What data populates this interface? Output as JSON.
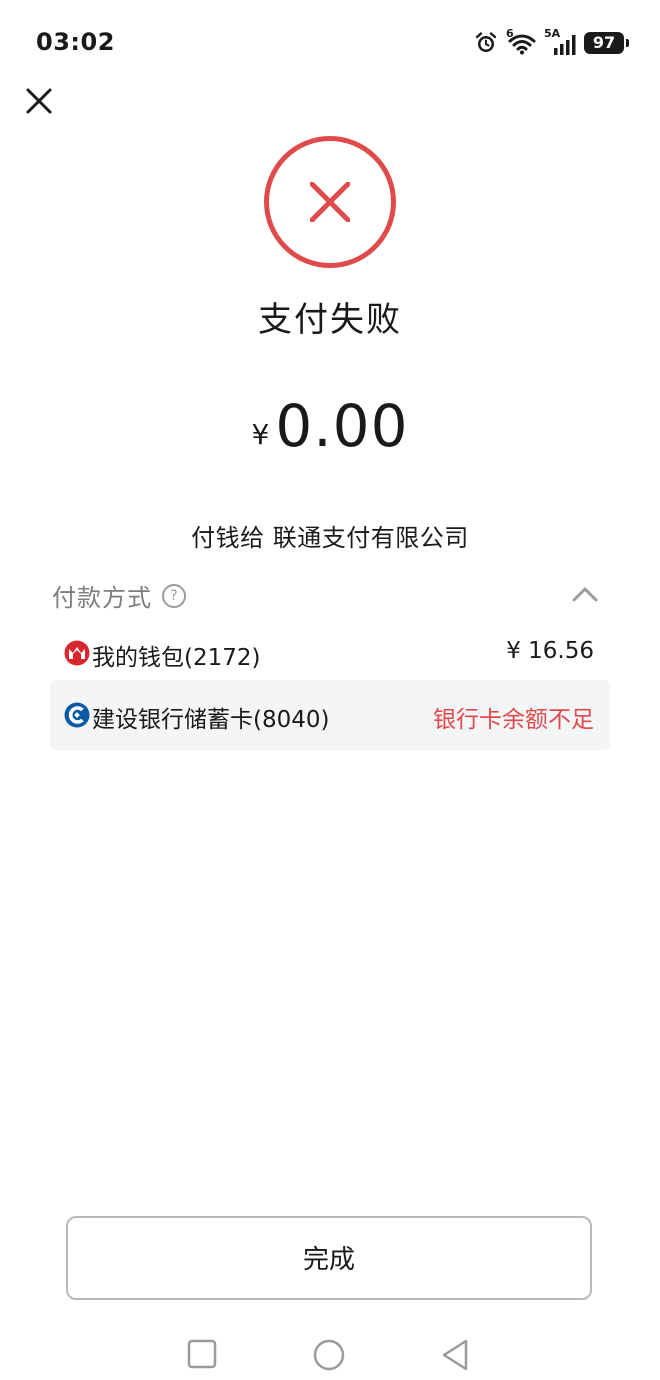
{
  "status_bar": {
    "time": "03:02",
    "network_wifi_label": "6",
    "network_cell_label": "5A",
    "battery": "97"
  },
  "result": {
    "title": "支付失败",
    "currency": "¥",
    "amount": "0.00",
    "payee": "付钱给 联通支付有限公司",
    "fail_color": "#e04a4a"
  },
  "payment_method": {
    "title": "付款方式",
    "help": "?",
    "options": [
      {
        "label": "我的钱包(2172)",
        "right": "¥ 16.56"
      },
      {
        "label": "建设银行储蓄卡(8040)",
        "right": "银行卡余额不足"
      }
    ]
  },
  "actions": {
    "done_label": "完成"
  }
}
